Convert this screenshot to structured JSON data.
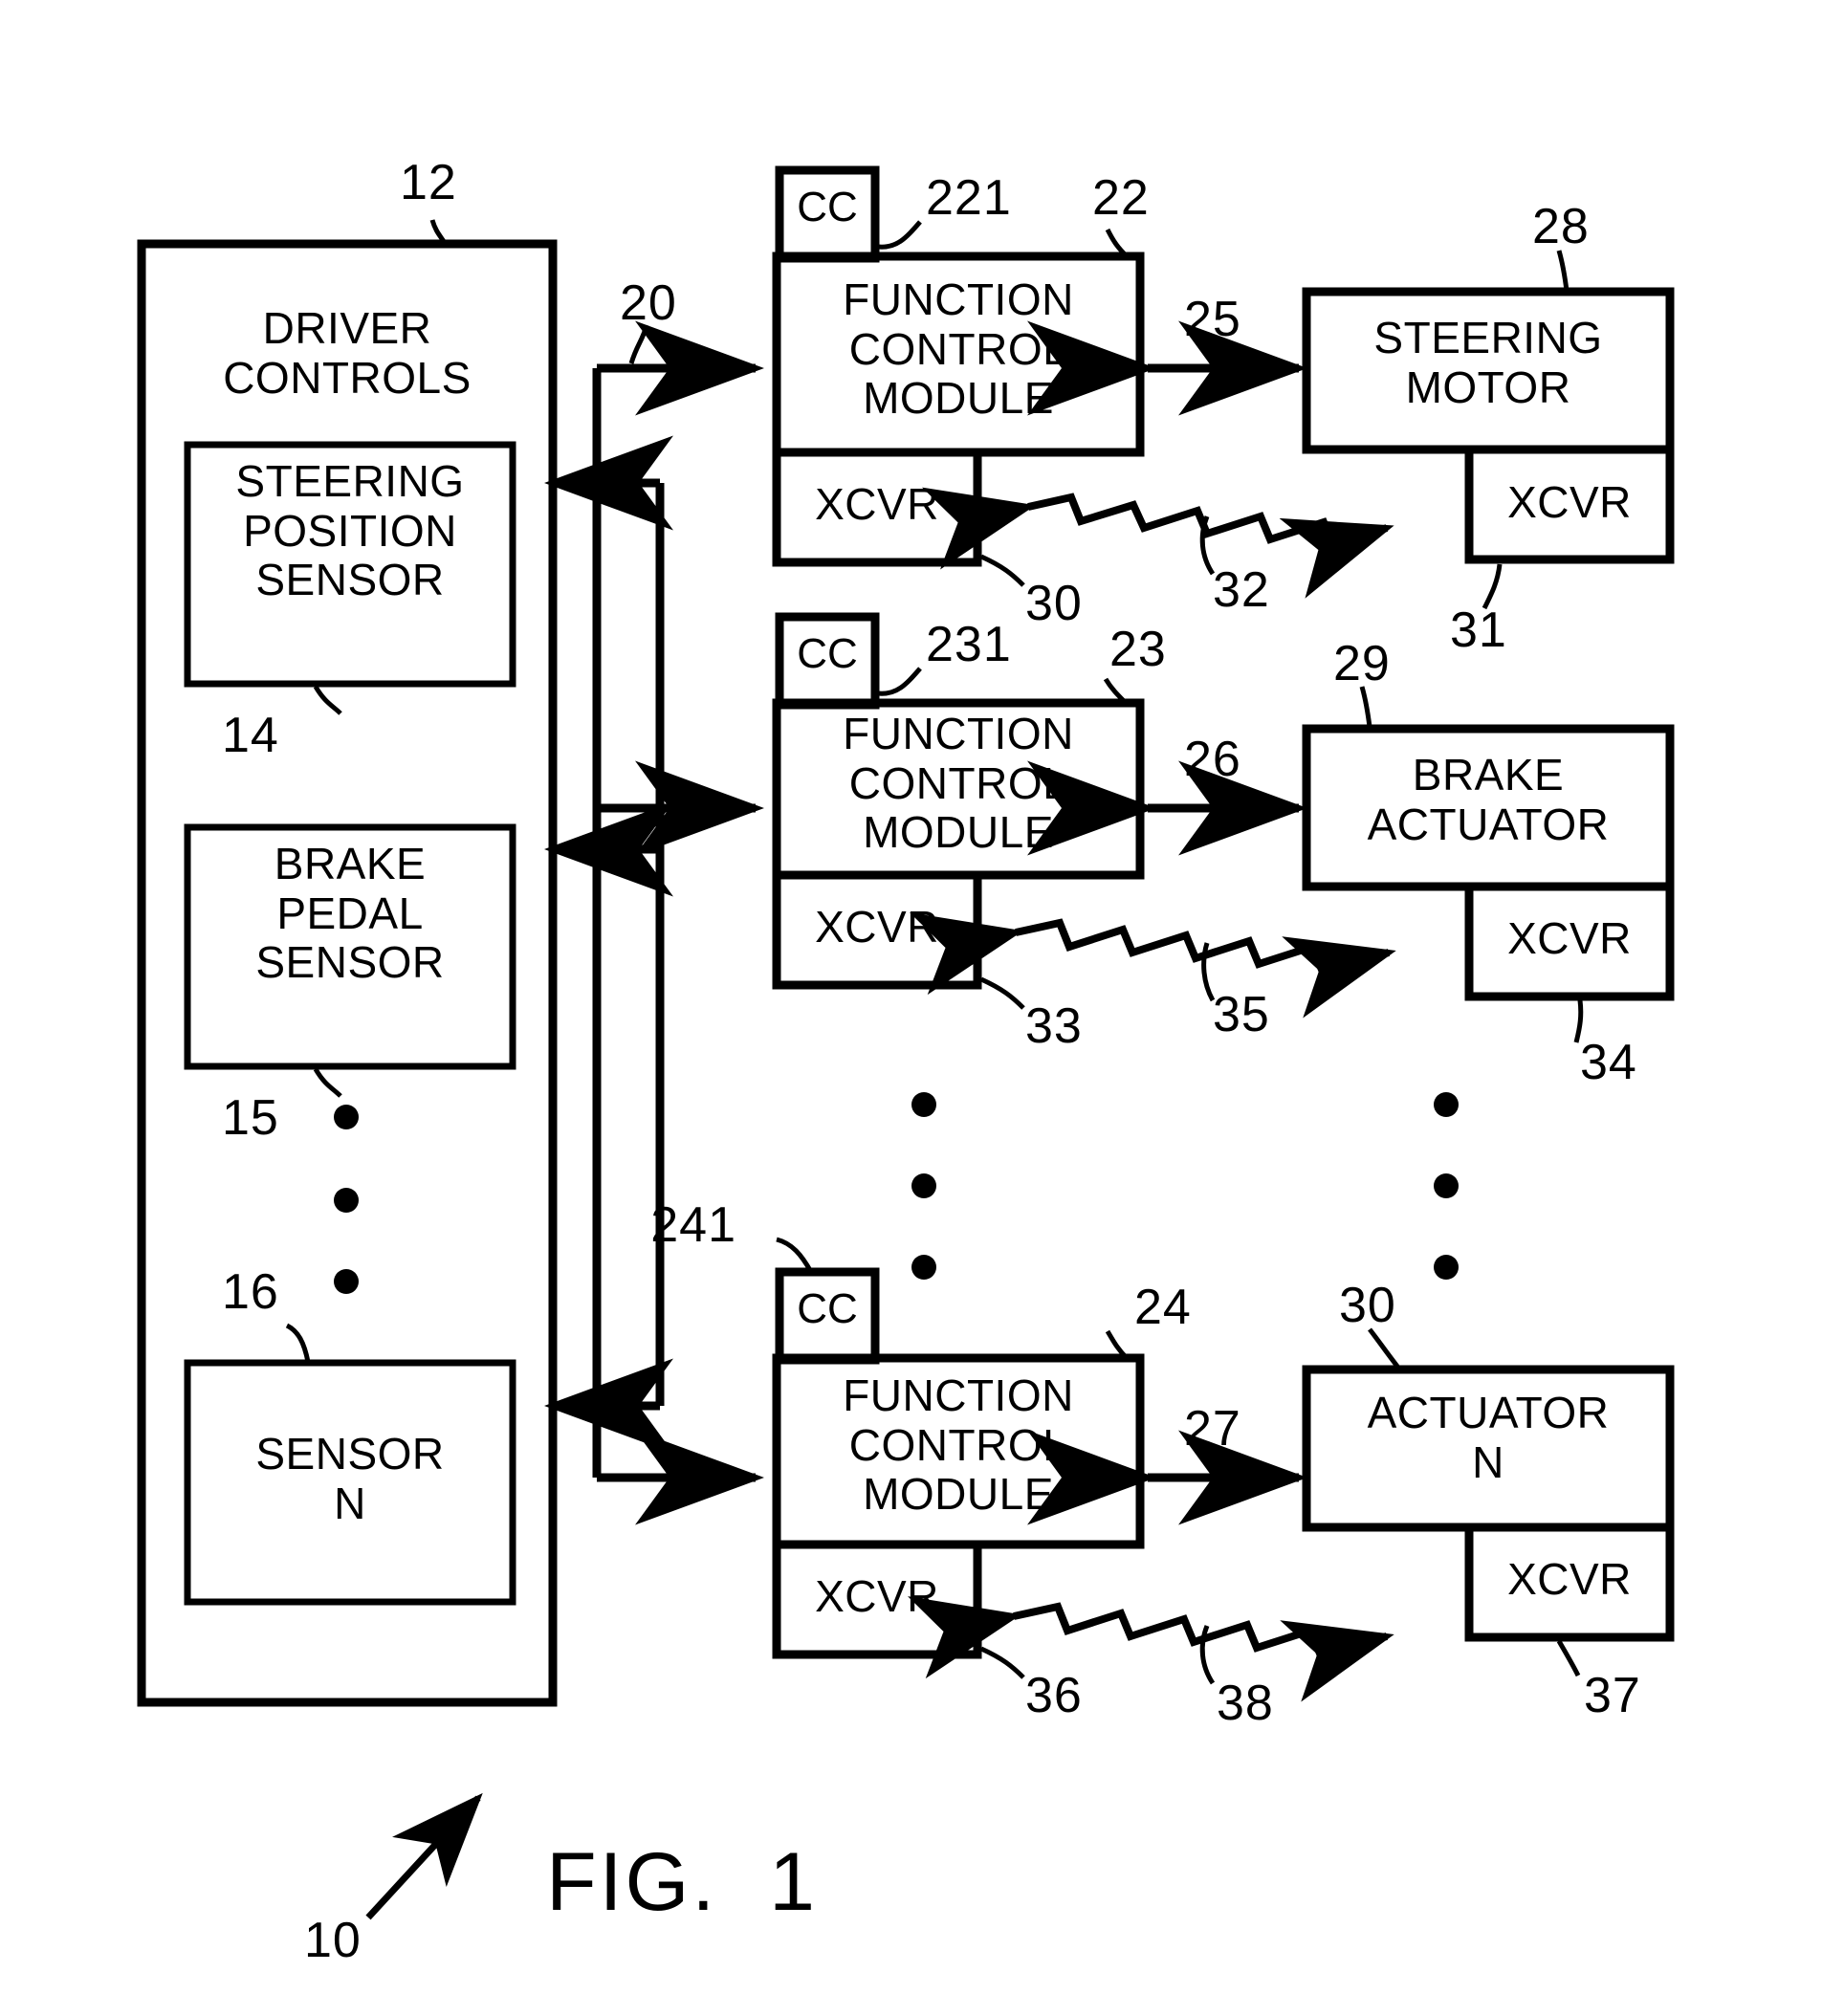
{
  "figure": {
    "caption": "FIG.  1",
    "system_ref": "10"
  },
  "driver_controls": {
    "title_line1": "DRIVER",
    "title_line2": "CONTROLS",
    "ref": "12",
    "sensors": [
      {
        "lines": [
          "STEERING",
          "POSITION",
          "SENSOR"
        ],
        "ref": "14"
      },
      {
        "lines": [
          "BRAKE",
          "PEDAL",
          "SENSOR"
        ],
        "ref": "15"
      },
      {
        "lines": [
          "SENSOR",
          "N"
        ],
        "ref": "16"
      }
    ]
  },
  "bus": {
    "ref": "20"
  },
  "rows": [
    {
      "cc_label": "CC",
      "cc_ref": "221",
      "module_lines": [
        "FUNCTION",
        "CONTROL",
        "MODULE"
      ],
      "module_ref": "22",
      "module_xcvr_label": "XCVR",
      "module_xcvr_ref": "30",
      "link_ref": "25",
      "wireless_ref": "32",
      "device_lines": [
        "STEERING",
        "MOTOR"
      ],
      "device_ref": "28",
      "device_xcvr_label": "XCVR",
      "device_xcvr_ref": "31"
    },
    {
      "cc_label": "CC",
      "cc_ref": "231",
      "module_lines": [
        "FUNCTION",
        "CONTROL",
        "MODULE"
      ],
      "module_ref": "23",
      "module_xcvr_label": "XCVR",
      "module_xcvr_ref": "33",
      "link_ref": "26",
      "wireless_ref": "35",
      "device_lines": [
        "BRAKE",
        "ACTUATOR"
      ],
      "device_ref": "29",
      "device_xcvr_label": "XCVR",
      "device_xcvr_ref": "34"
    },
    {
      "cc_label": "CC",
      "cc_ref": "241",
      "module_lines": [
        "FUNCTION",
        "CONTROL",
        "MODULE"
      ],
      "module_ref": "24",
      "module_xcvr_label": "XCVR",
      "module_xcvr_ref": "36",
      "link_ref": "27",
      "wireless_ref": "38",
      "device_lines": [
        "ACTUATOR",
        "N"
      ],
      "device_ref": "30",
      "device_xcvr_label": "XCVR",
      "device_xcvr_ref": "37"
    }
  ],
  "ellipses": {
    "note": "vertical three-dot continuation marks",
    "columns": 3
  },
  "colors": {
    "ink": "#000000",
    "paper": "#ffffff"
  }
}
